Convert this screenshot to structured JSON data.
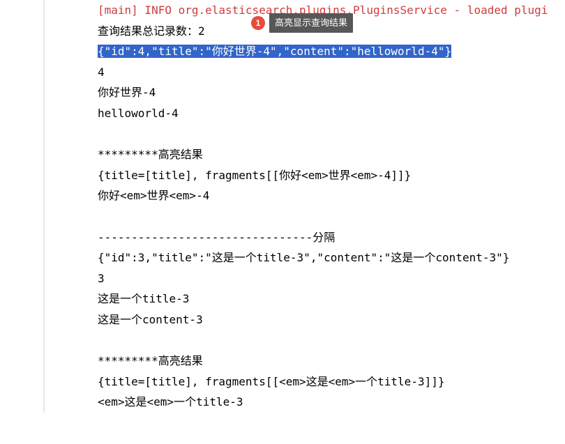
{
  "log_header": "[main] INFO org.elasticsearch.plugins.PluginsService - loaded plugi",
  "annotation": {
    "number": "1",
    "label": "高亮显示查询结果"
  },
  "lines": {
    "l1": "查询结果总记录数：2",
    "l2": "{\"id\":4,\"title\":\"你好世界-4\",\"content\":\"helloworld-4\"}",
    "l3": "4",
    "l4": "你好世界-4",
    "l5": "helloworld-4",
    "l6": "*********高亮结果",
    "l7": "{title=[title], fragments[[你好<em>世界<em>-4]]}",
    "l8": "你好<em>世界<em>-4",
    "l9": "--------------------------------分隔",
    "l10": "{\"id\":3,\"title\":\"这是一个title-3\",\"content\":\"这是一个content-3\"}",
    "l11": "3",
    "l12": "这是一个title-3",
    "l13": "这是一个content-3",
    "l14": "*********高亮结果",
    "l15": "{title=[title], fragments[[<em>这是<em>一个title-3]]}",
    "l16": "<em>这是<em>一个title-3"
  }
}
